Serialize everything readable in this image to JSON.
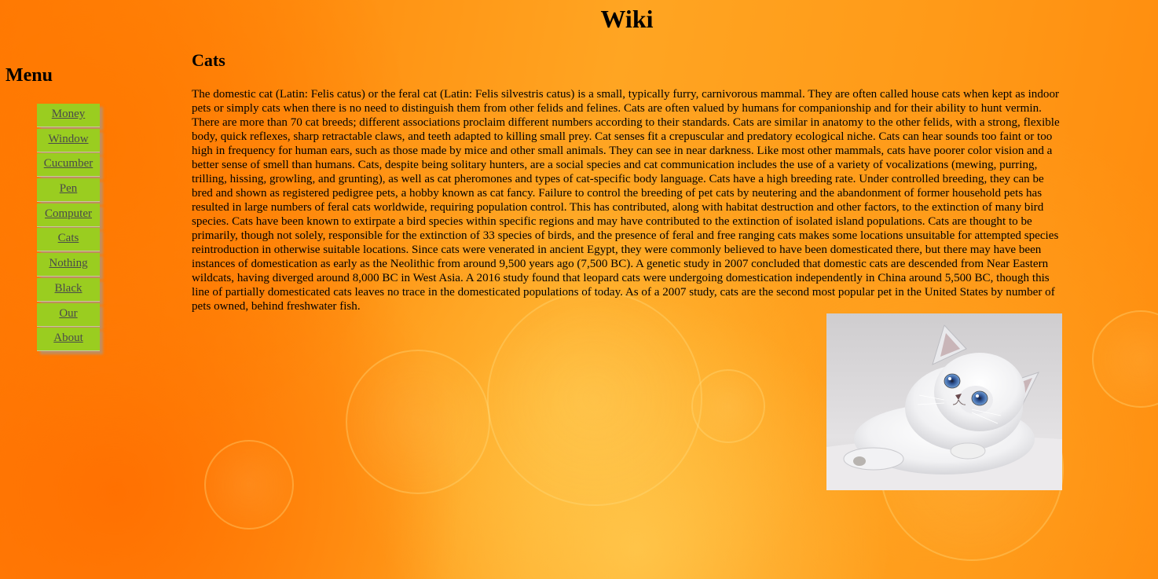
{
  "header": {
    "title": "Wiki"
  },
  "sidebar": {
    "heading": "Menu",
    "items": [
      {
        "label": "Money"
      },
      {
        "label": "Window"
      },
      {
        "label": "Cucumber"
      },
      {
        "label": "Pen"
      },
      {
        "label": "Computer"
      },
      {
        "label": "Cats"
      },
      {
        "label": "Nothing"
      },
      {
        "label": "Black"
      },
      {
        "label": "Our"
      },
      {
        "label": "About"
      }
    ]
  },
  "main": {
    "title": "Cats",
    "body": "The domestic cat (Latin: Felis catus) or the feral cat (Latin: Felis silvestris catus) is a small, typically furry, carnivorous mammal. They are often called house cats when kept as indoor pets or simply cats when there is no need to distinguish them from other felids and felines. Cats are often valued by humans for companionship and for their ability to hunt vermin. There are more than 70 cat breeds; different associations proclaim different numbers according to their standards. Cats are similar in anatomy to the other felids, with a strong, flexible body, quick reflexes, sharp retractable claws, and teeth adapted to killing small prey. Cat senses fit a crepuscular and predatory ecological niche. Cats can hear sounds too faint or too high in frequency for human ears, such as those made by mice and other small animals. They can see in near darkness. Like most other mammals, cats have poorer color vision and a better sense of smell than humans. Cats, despite being solitary hunters, are a social species and cat communication includes the use of a variety of vocalizations (mewing, purring, trilling, hissing, growling, and grunting), as well as cat pheromones and types of cat-specific body language. Cats have a high breeding rate. Under controlled breeding, they can be bred and shown as registered pedigree pets, a hobby known as cat fancy. Failure to control the breeding of pet cats by neutering and the abandonment of former household pets has resulted in large numbers of feral cats worldwide, requiring population control. This has contributed, along with habitat destruction and other factors, to the extinction of many bird species. Cats have been known to extirpate a bird species within specific regions and may have contributed to the extinction of isolated island populations. Cats are thought to be primarily, though not solely, responsible for the extinction of 33 species of birds, and the presence of feral and free ranging cats makes some locations unsuitable for attempted species reintroduction in otherwise suitable locations. Since cats were venerated in ancient Egypt, they were commonly believed to have been domesticated there, but there may have been instances of domestication as early as the Neolithic from around 9,500 years ago (7,500 BC). A genetic study in 2007 concluded that domestic cats are descended from Near Eastern wildcats, having diverged around 8,000 BC in West Asia. A 2016 study found that leopard cats were undergoing domestication independently in China around 5,500 BC, though this line of partially domesticated cats leaves no trace in the domesticated populations of today. As of a 2007 study, cats are the second most popular pet in the United States by number of pets owned, behind freshwater fish."
  },
  "theme": {
    "background_accent": "#ff8c10",
    "menu_item_color": "#9acd20",
    "link_color": "#4a4a4a"
  }
}
